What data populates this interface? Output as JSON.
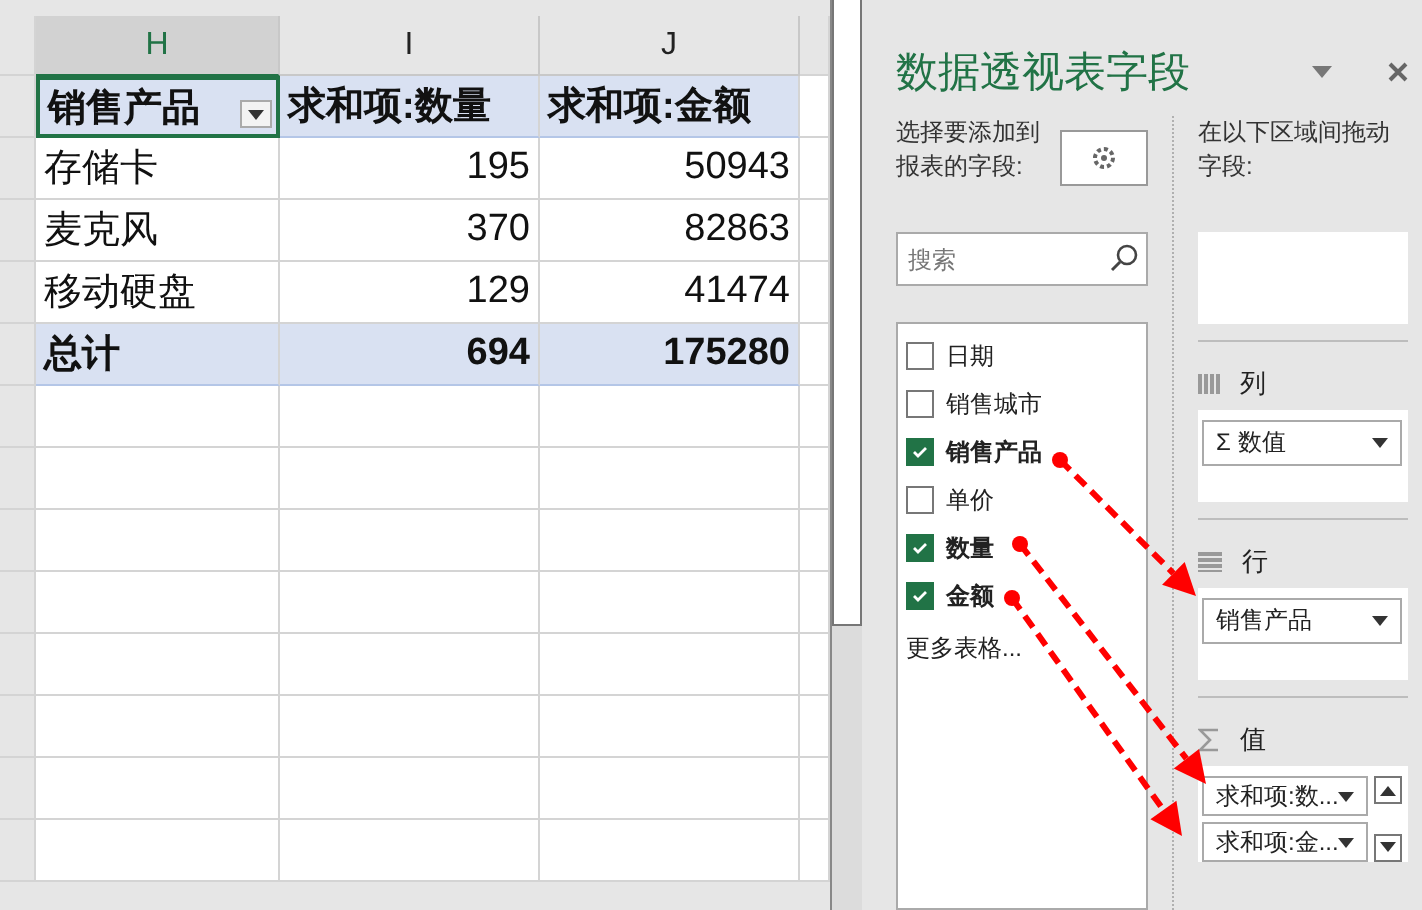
{
  "sheet": {
    "columns": [
      {
        "label": "H",
        "selected": true
      },
      {
        "label": "I",
        "selected": false
      },
      {
        "label": "J",
        "selected": false
      }
    ],
    "header": [
      "销售产品",
      "求和项:数量",
      "求和项:金额"
    ],
    "rows": [
      [
        "存储卡",
        "195",
        "50943"
      ],
      [
        "麦克风",
        "370",
        "82863"
      ],
      [
        "移动硬盘",
        "129",
        "41474"
      ]
    ],
    "total": [
      "总计",
      "694",
      "175280"
    ]
  },
  "panel": {
    "title": "数据透视表字段",
    "choose_label": "选择要添加到报表的字段:",
    "search": {
      "placeholder": "搜索"
    },
    "fields": [
      {
        "label": "日期",
        "checked": false
      },
      {
        "label": "销售城市",
        "checked": false
      },
      {
        "label": "销售产品",
        "checked": true
      },
      {
        "label": "单价",
        "checked": false
      },
      {
        "label": "数量",
        "checked": true
      },
      {
        "label": "金额",
        "checked": true
      }
    ],
    "more_tables": "更多表格...",
    "drag_label": "在以下区域间拖动字段:",
    "areas": [
      {
        "kind": "filters"
      },
      {
        "kind": "columns",
        "label": "列",
        "items": [
          "Σ 数值"
        ]
      },
      {
        "kind": "rows",
        "label": "行",
        "items": [
          "销售产品"
        ]
      },
      {
        "kind": "values",
        "label": "值",
        "items": [
          "求和项:数...",
          "求和项:金..."
        ]
      }
    ]
  }
}
